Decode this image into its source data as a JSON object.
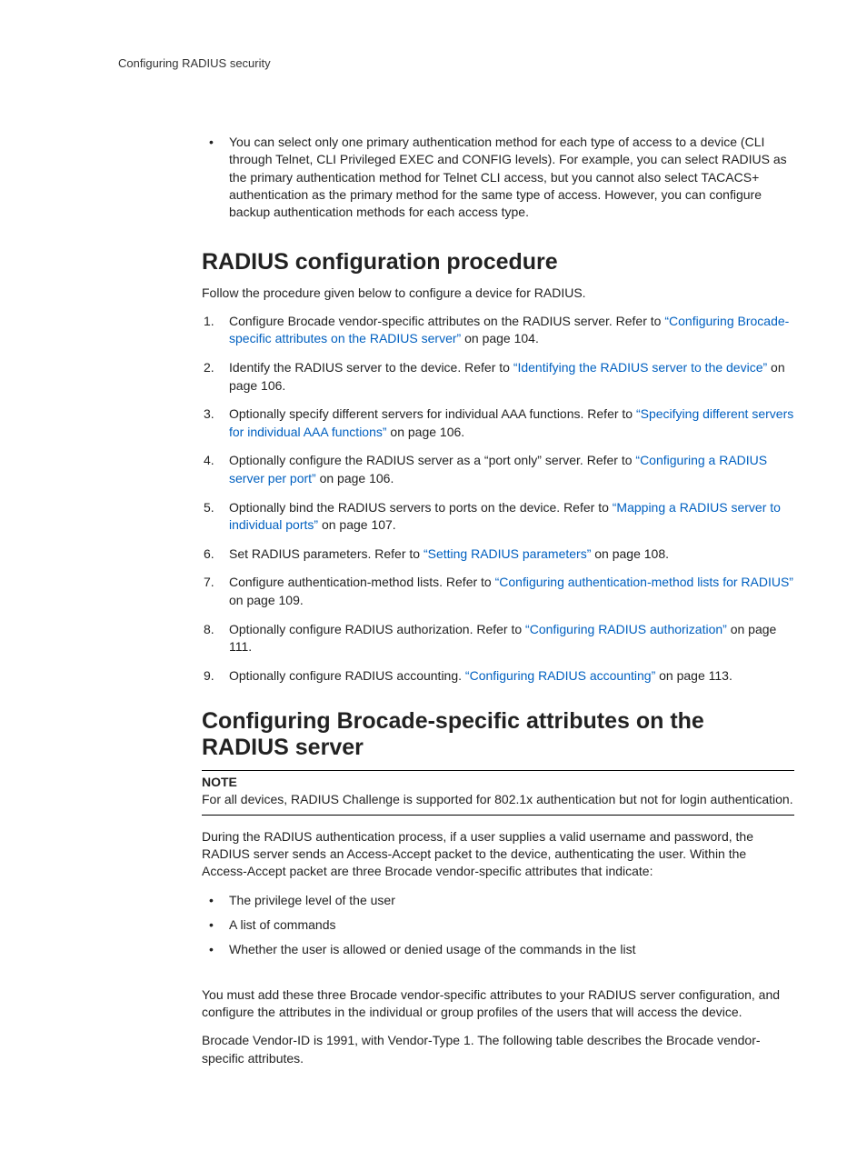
{
  "runningHead": "Configuring RADIUS security",
  "topBullet": "You can select only one primary authentication method for each type of access to a device (CLI through Telnet, CLI Privileged EXEC and CONFIG levels). For example, you can select RADIUS as the primary authentication method for Telnet CLI access, but you cannot also select TACACS+ authentication as the primary method for the same type of access. However, you can configure backup authentication methods for each access type.",
  "section1": {
    "heading": "RADIUS configuration procedure",
    "intro": "Follow the procedure given below to configure a device for RADIUS.",
    "steps": [
      {
        "pre": "Configure Brocade vendor-specific attributes on the RADIUS server. Refer to ",
        "link": "“Configuring Brocade-specific attributes on the RADIUS server”",
        "post": " on page 104."
      },
      {
        "pre": "Identify the RADIUS server to the device. Refer to ",
        "link": "“Identifying the RADIUS server to the device”",
        "post": " on page 106."
      },
      {
        "pre": "Optionally specify different servers for individual AAA functions. Refer to ",
        "link": "“Specifying different servers for individual AAA functions”",
        "post": " on page 106."
      },
      {
        "pre": "Optionally configure the RADIUS server as a “port only” server. Refer to ",
        "link": "“Configuring a RADIUS server per port”",
        "post": " on page 106."
      },
      {
        "pre": "Optionally bind the RADIUS servers to ports on the device. Refer to ",
        "link": "“Mapping a RADIUS server to individual ports”",
        "post": " on page 107."
      },
      {
        "pre": "Set RADIUS parameters. Refer to ",
        "link": "“Setting RADIUS parameters”",
        "post": " on page 108."
      },
      {
        "pre": "Configure authentication-method lists. Refer to ",
        "link": "“Configuring authentication-method lists for RADIUS”",
        "post": " on page 109."
      },
      {
        "pre": "Optionally configure RADIUS authorization. Refer to ",
        "link": "“Configuring RADIUS authorization”",
        "post": " on page 111."
      },
      {
        "pre": "Optionally configure RADIUS accounting. ",
        "link": "“Configuring RADIUS accounting”",
        "post": " on page 113."
      }
    ]
  },
  "section2": {
    "heading": "Configuring Brocade-specific attributes on the RADIUS server",
    "noteLabel": "NOTE",
    "noteText": "For all devices, RADIUS Challenge is supported for 802.1x authentication but not for login authentication.",
    "para1": "During the RADIUS authentication process, if a user supplies a valid username and password, the RADIUS server sends an Access-Accept packet to the device, authenticating the user. Within the Access-Accept packet are three Brocade vendor-specific attributes that indicate:",
    "bullets": [
      "The privilege level of the user",
      "A list of commands",
      "Whether the user is allowed or denied usage of the commands in the list"
    ],
    "para2": "You must add these three Brocade vendor-specific attributes to your RADIUS server configuration, and configure the attributes in the individual or group profiles of the users that will access the device.",
    "para3": "Brocade Vendor-ID is 1991, with Vendor-Type 1. The following table describes the Brocade vendor-specific attributes."
  }
}
